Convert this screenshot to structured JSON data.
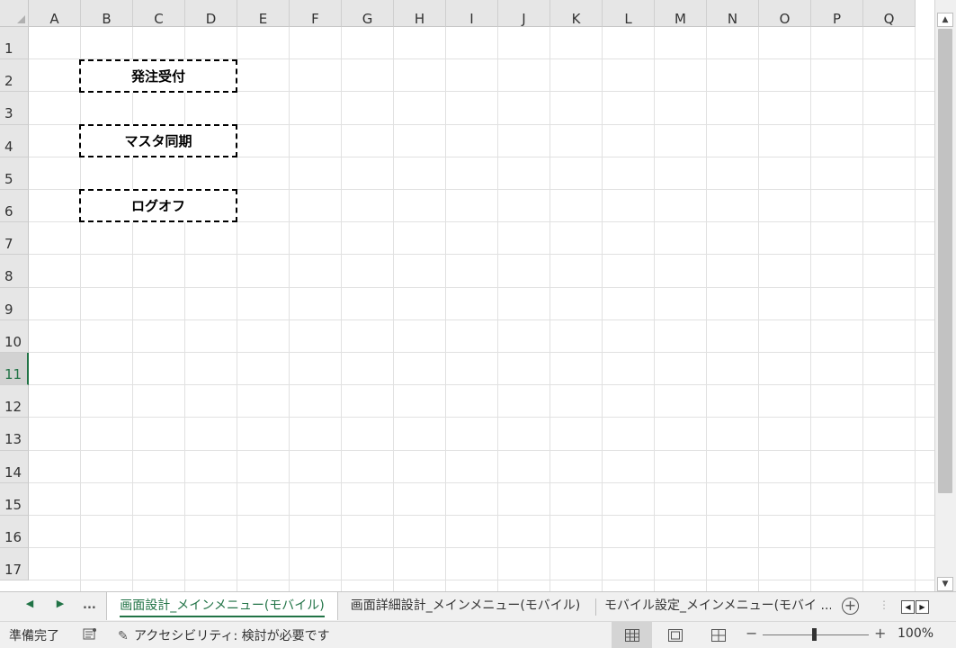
{
  "sheet": {
    "columns": [
      "A",
      "B",
      "C",
      "D",
      "E",
      "F",
      "G",
      "H",
      "I",
      "J",
      "K",
      "L",
      "M",
      "N",
      "O",
      "P",
      "Q"
    ],
    "rows": [
      "1",
      "2",
      "3",
      "4",
      "5",
      "6",
      "7",
      "8",
      "9",
      "10",
      "11",
      "12",
      "13",
      "14",
      "15",
      "16",
      "17"
    ],
    "selected_row": "11"
  },
  "shapes": {
    "order_receive": "発注受付",
    "master_sync": "マスタ同期",
    "logoff": "ログオフ"
  },
  "sheet_tabs": {
    "more": "...",
    "tabs": [
      {
        "label": "画面設計_メインメニュー(モバイル)",
        "active": true
      },
      {
        "label": "画面詳細設計_メインメニュー(モバイル)",
        "active": false
      },
      {
        "label": "モバイル設定_メインメニュー(モバイ ...",
        "active": false
      }
    ],
    "add": "+"
  },
  "status": {
    "ready": "準備完了",
    "accessibility": "アクセシビリティ: 検討が必要です",
    "zoom": "100%",
    "zoom_minus": "−",
    "zoom_plus": "+"
  },
  "colors": {
    "accent": "#217346",
    "header_bg": "#e6e6e6",
    "gridline": "#e1e1e1"
  }
}
